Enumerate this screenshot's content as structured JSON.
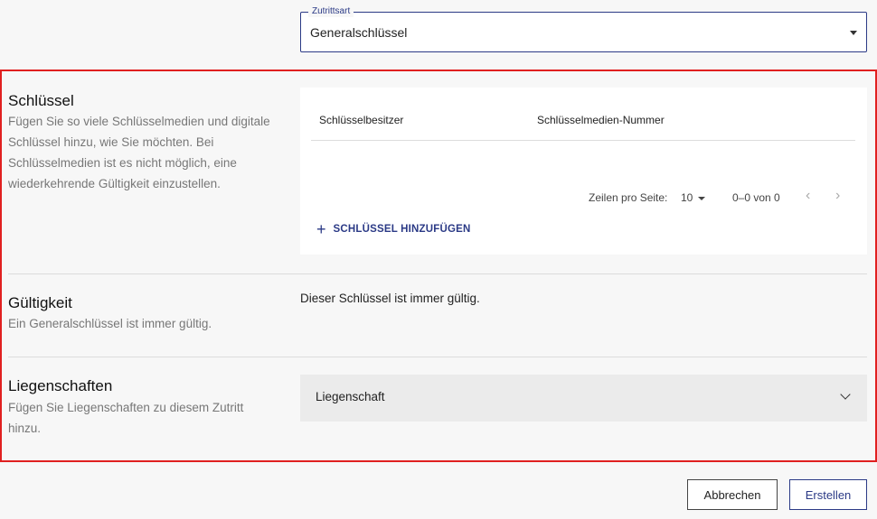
{
  "access_type": {
    "label": "Zutrittsart",
    "value": "Generalschlüssel"
  },
  "keys_section": {
    "title": "Schlüssel",
    "description": "Fügen Sie so viele Schlüsselmedien und digitale Schlüssel hinzu, wie Sie möchten. Bei Schlüsselmedien ist es nicht möglich, eine wiederkehrende Gültigkeit einzustellen.",
    "table": {
      "columns": [
        "Schlüsselbesitzer",
        "Schlüsselmedien-Nummer"
      ],
      "rows": []
    },
    "pagination": {
      "rows_per_page_label": "Zeilen pro Seite:",
      "rows_per_page": "10",
      "range": "0–0 von 0",
      "prev_icon": "chevron-left-icon",
      "next_icon": "chevron-right-icon"
    },
    "add_key_label": "SCHLÜSSEL HINZUFÜGEN"
  },
  "validity_section": {
    "title": "Gültigkeit",
    "description": "Ein Generalschlüssel ist immer gültig.",
    "info": "Dieser Schlüssel ist immer gültig."
  },
  "properties_section": {
    "title": "Liegenschaften",
    "description": "Fügen Sie Liegenschaften zu diesem Zutritt hinzu.",
    "select_label": "Liegenschaft"
  },
  "actions": {
    "cancel_label": "Abbrechen",
    "create_label": "Erstellen"
  },
  "colors": {
    "accent": "#2b3a86",
    "highlight": "#e02020"
  }
}
